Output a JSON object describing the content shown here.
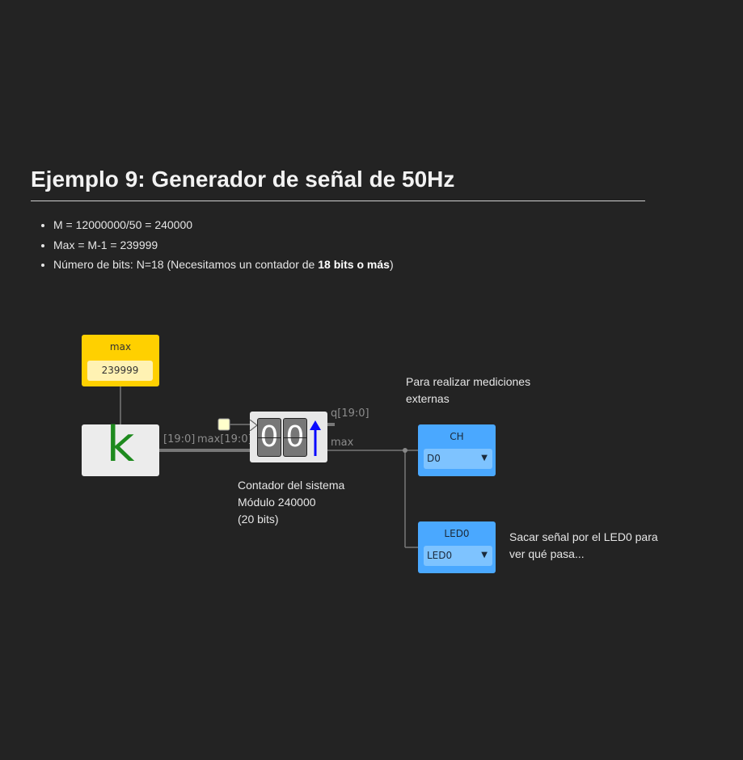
{
  "heading": "Ejemplo 9: Generador de señal de 50Hz",
  "bullets": {
    "item1": "M = 12000000/50 = 240000",
    "item2": "Max = M-1 = 239999",
    "item3_prefix": "Número de bits: N=18 (Necesitamos un contador de ",
    "item3_bold": "18 bits o más",
    "item3_suffix": ")"
  },
  "constant_block": {
    "label": "max",
    "value": "239999",
    "color": "#ffd000"
  },
  "k_block": {
    "symbol": "k",
    "symbol_color": "#1e8a1e"
  },
  "wires": {
    "bus_k": "[19:0]",
    "bus_max_in": "max[19:0]",
    "counter_q": "q[19:0]",
    "counter_max": "max"
  },
  "counter_block": {
    "digits": [
      "0",
      "0"
    ],
    "icon": "up-arrow-icon",
    "note_line1": "Contador del sistema",
    "note_line2": "Módulo 240000",
    "note_line3": "(20 bits)"
  },
  "output_ch": {
    "label": "CH",
    "selected": "D0",
    "note_line1": "Para realizar mediciones",
    "note_line2": "externas",
    "color": "#4aa8ff"
  },
  "output_led": {
    "label": "LED0",
    "selected": "LED0",
    "note_line1": "Sacar señal por el LED0 para",
    "note_line2": "ver qué pasa..."
  }
}
